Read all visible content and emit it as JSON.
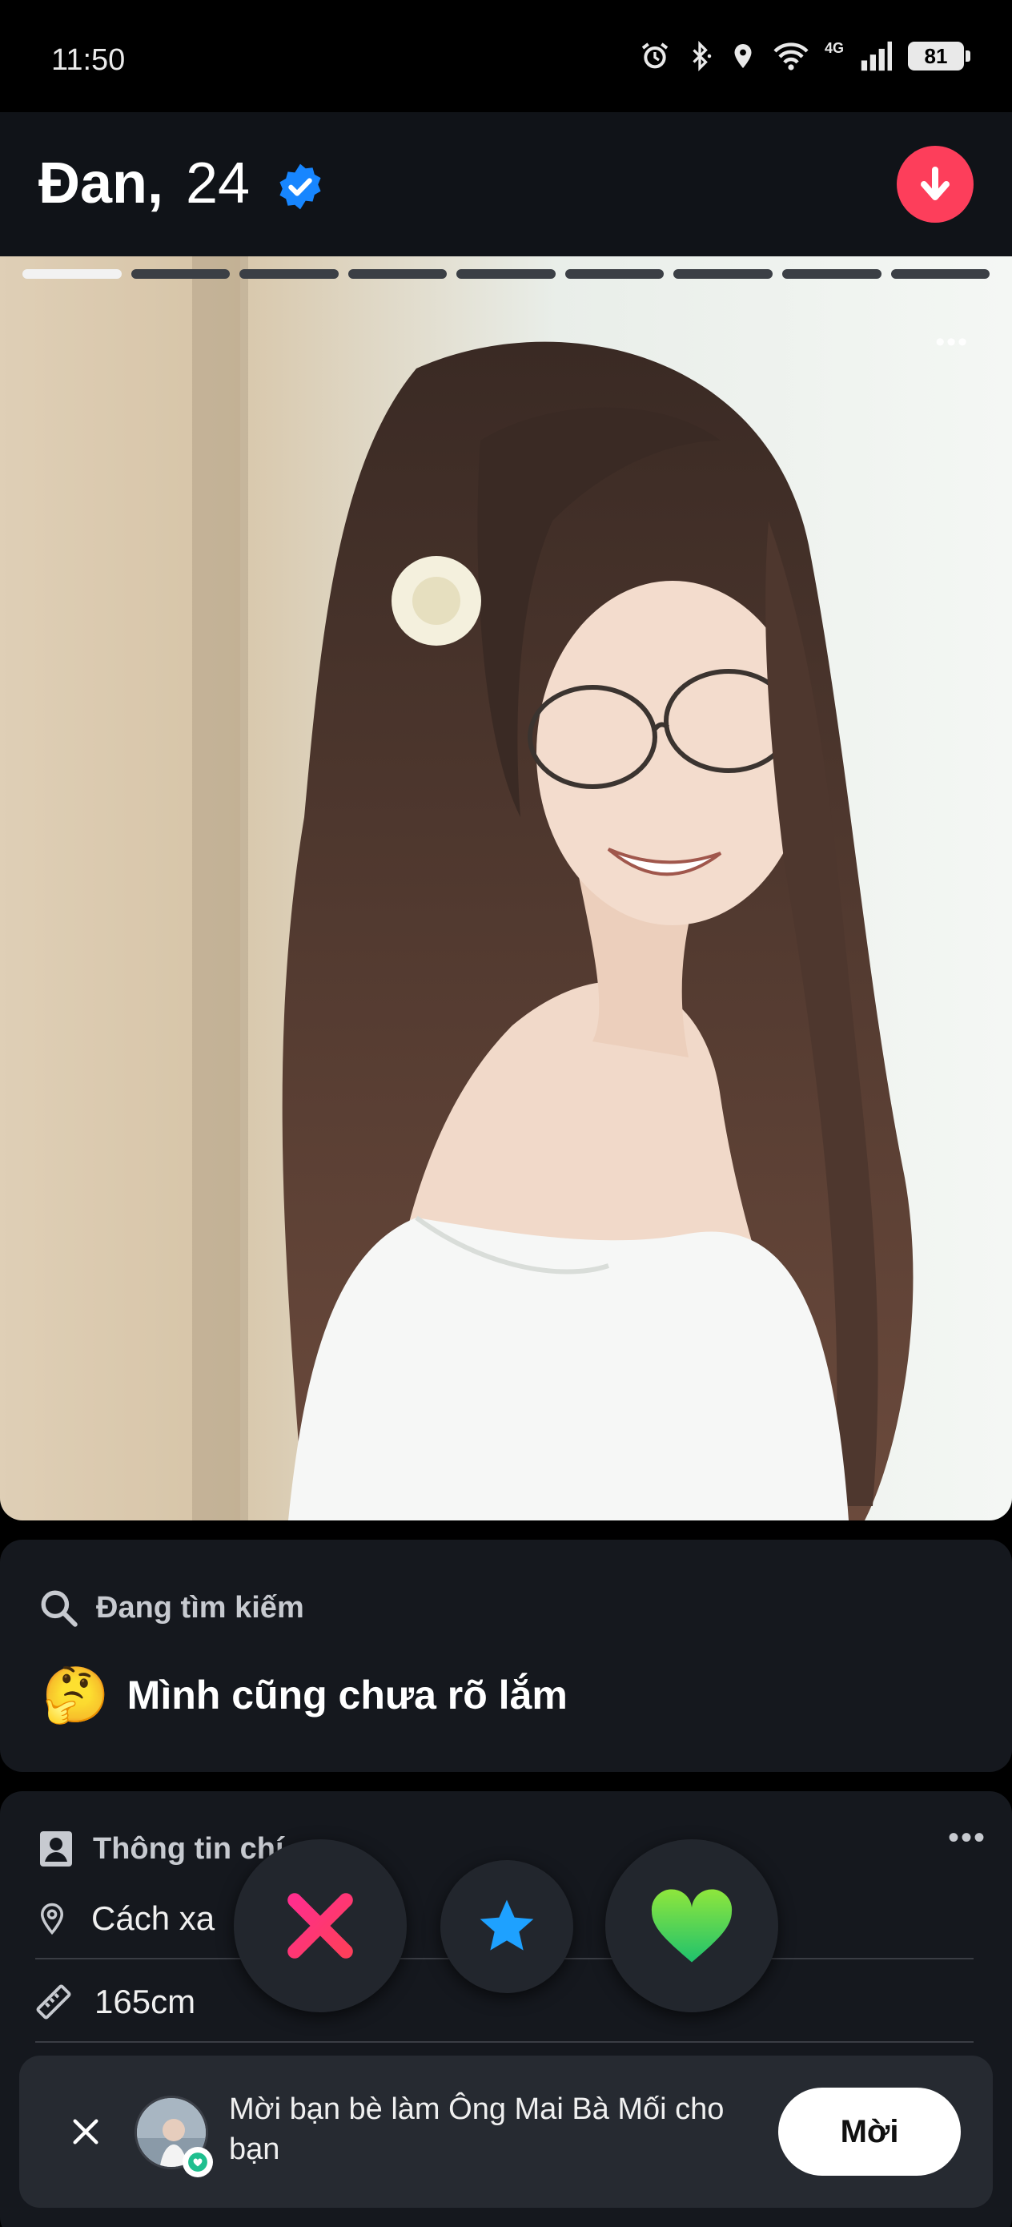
{
  "status_bar": {
    "time": "11:50",
    "network": "4G",
    "battery": "81",
    "icons": [
      "alarm-icon",
      "bluetooth-icon",
      "location-icon",
      "wifi-icon",
      "signal-icon",
      "battery-icon"
    ]
  },
  "profile": {
    "name": "Đan,",
    "age": "24",
    "verified": true
  },
  "photo": {
    "count": 9,
    "current_index": 1
  },
  "looking_for": {
    "label": "Đang tìm kiếm",
    "emoji": "🤔",
    "value": "Mình cũng chưa rõ lắm"
  },
  "basic_info": {
    "title": "Thông tin chí",
    "distance": "Cách xa",
    "height": "165cm"
  },
  "actions": {
    "nope_icon": "close-x-icon",
    "superlike_icon": "star-icon",
    "like_icon": "heart-icon"
  },
  "invite_banner": {
    "text": "Mời bạn bè làm Ông Mai Bà Mối cho bạn",
    "button": "Mời"
  },
  "colors": {
    "header_bg": "#101318",
    "card_bg": "#15181e",
    "accent_red": "#fd3e5b",
    "verified_blue": "#1786ff",
    "nope_pink": "#fd267a",
    "star_blue": "#1ea1ff",
    "like_green": "#5fdc29"
  }
}
